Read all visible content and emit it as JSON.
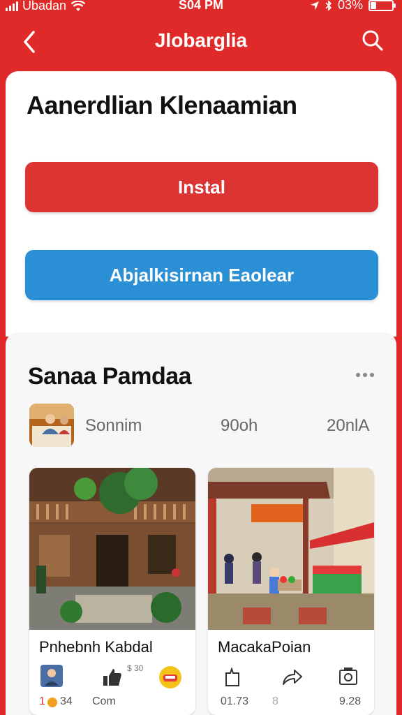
{
  "status_bar": {
    "carrier": "Ubadan",
    "time": "S04 PM",
    "battery": "03%",
    "battery_level": 0.25
  },
  "header": {
    "title": "Jlobarglia",
    "back_icon": "chevron-left-icon",
    "search_icon": "search-icon"
  },
  "main": {
    "heading": "Aanerdlian Klenaamian",
    "install_label": "Instal",
    "apply_label": "Abjalkisirnan Eaolear",
    "colors": {
      "install": "#dc3333",
      "apply": "#2b8fd6",
      "brand": "#e02a2a"
    }
  },
  "section": {
    "title": "Sanaa Pamdaa",
    "stats": [
      "Sonnim",
      "90oh",
      "20nlA"
    ],
    "cards": [
      {
        "title": "Pnhebnh Kabdal",
        "badge": "$ 30",
        "counts": [
          "1",
          "34",
          "Com"
        ]
      },
      {
        "title": "MacakaPoian",
        "counts": [
          "01.73",
          "8",
          "9.28"
        ]
      }
    ]
  }
}
